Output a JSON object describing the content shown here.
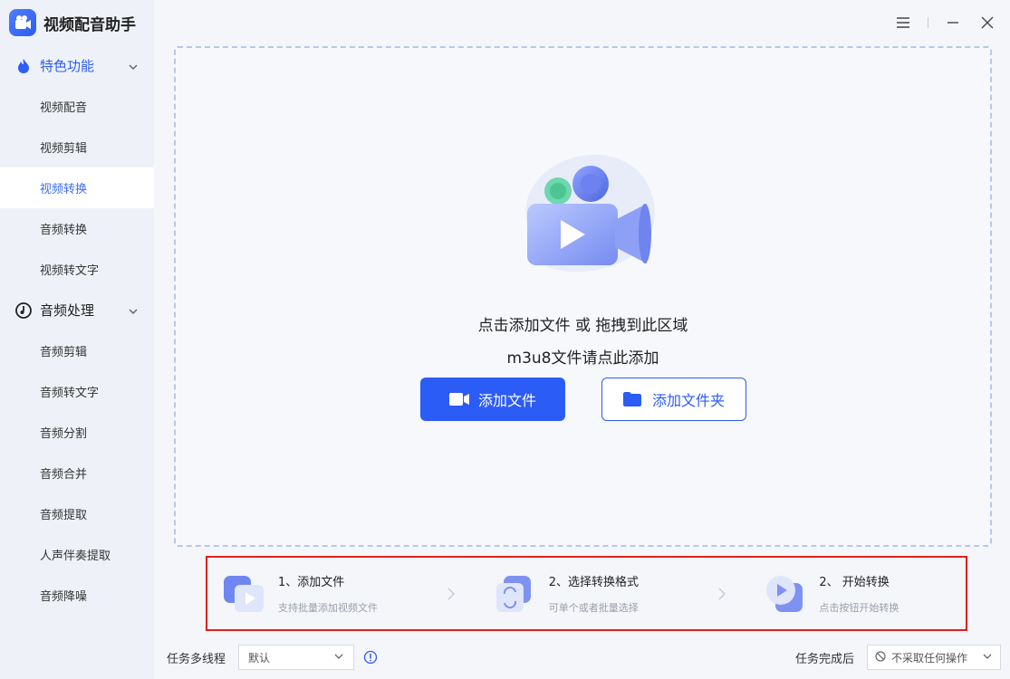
{
  "app": {
    "title": "视频配音助手"
  },
  "sidebar": {
    "groups": [
      {
        "label": "特色功能",
        "items": [
          "视频配音",
          "视频剪辑",
          "视频转换",
          "音频转换",
          "视频转文字"
        ]
      },
      {
        "label": "音频处理",
        "items": [
          "音频剪辑",
          "音频转文字",
          "音频分割",
          "音频合并",
          "音频提取",
          "人声伴奏提取",
          "音频降噪"
        ]
      }
    ],
    "selected_item": "视频转换"
  },
  "dropzone": {
    "line1": "点击添加文件 或 拖拽到此区域",
    "line2": "m3u8文件请点此添加",
    "add_file_label": "添加文件",
    "add_folder_label": "添加文件夹"
  },
  "steps": [
    {
      "title": "1、添加文件",
      "desc": "支持批量添加视频文件"
    },
    {
      "title": "2、选择转换格式",
      "desc": "可单个或者批量选择"
    },
    {
      "title": "2、 开始转换",
      "desc": "点击按钮开始转换"
    }
  ],
  "bottom": {
    "threads_label": "任务多线程",
    "threads_value": "默认",
    "after_label": "任务完成后",
    "after_value": "不采取任何操作"
  },
  "colors": {
    "accent": "#2c5cf6",
    "sidebar_bg": "#eef2f8",
    "highlight_border": "#e02020"
  }
}
